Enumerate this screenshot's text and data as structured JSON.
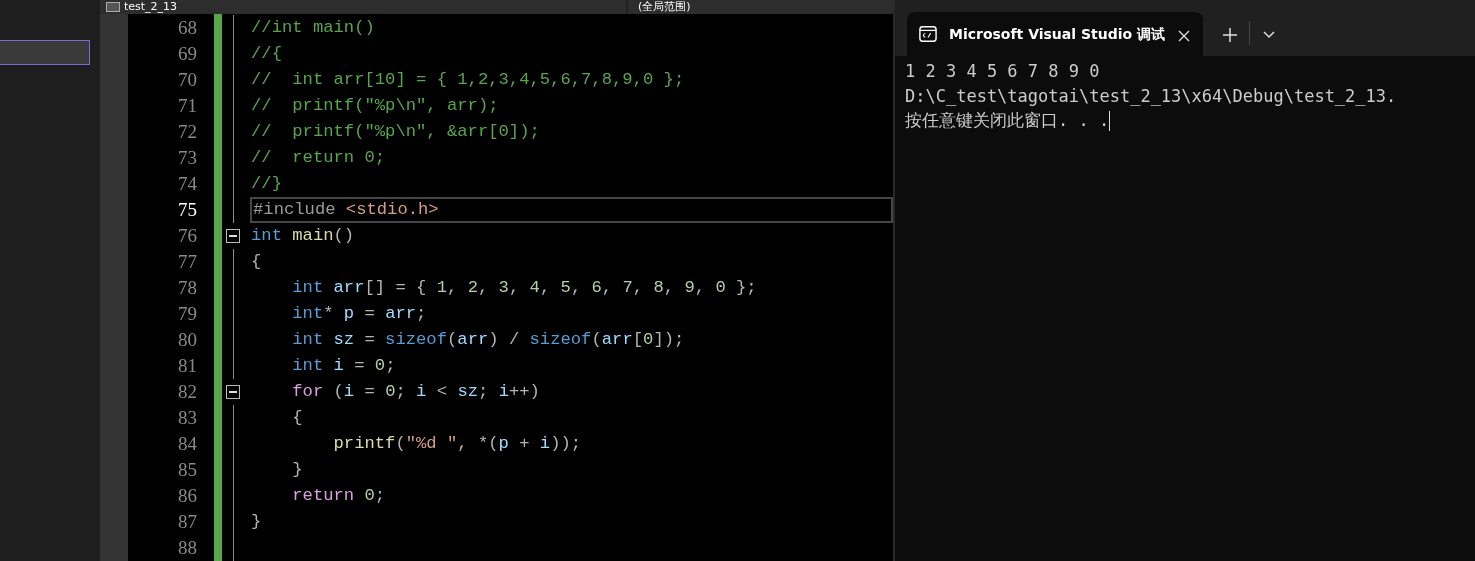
{
  "editor": {
    "file_tab": "test_2_13",
    "scope": "(全局范围)",
    "lines": [
      {
        "number": "68",
        "current": false,
        "foldable": false,
        "tokens": [
          {
            "kind": "comment",
            "text": "//int main()"
          }
        ]
      },
      {
        "number": "69",
        "current": false,
        "foldable": false,
        "tokens": [
          {
            "kind": "comment",
            "text": "//{"
          }
        ]
      },
      {
        "number": "70",
        "current": false,
        "foldable": false,
        "tokens": [
          {
            "kind": "comment",
            "text": "//  int arr[10] = { 1,2,3,4,5,6,7,8,9,0 };"
          }
        ]
      },
      {
        "number": "71",
        "current": false,
        "foldable": false,
        "tokens": [
          {
            "kind": "comment",
            "text": "//  printf(\"%p\\n\", arr);"
          }
        ]
      },
      {
        "number": "72",
        "current": false,
        "foldable": false,
        "tokens": [
          {
            "kind": "comment",
            "text": "//  printf(\"%p\\n\", &arr[0]);"
          }
        ]
      },
      {
        "number": "73",
        "current": false,
        "foldable": false,
        "tokens": [
          {
            "kind": "comment",
            "text": "//  return 0;"
          }
        ]
      },
      {
        "number": "74",
        "current": false,
        "foldable": false,
        "tokens": [
          {
            "kind": "comment",
            "text": "//}"
          }
        ]
      },
      {
        "number": "75",
        "current": true,
        "foldable": false,
        "tokens": [
          {
            "kind": "preproc",
            "text": "#include "
          },
          {
            "kind": "string",
            "text": "<stdio.h>"
          }
        ]
      },
      {
        "number": "76",
        "current": false,
        "foldable": true,
        "tokens": [
          {
            "kind": "keyword",
            "text": "int"
          },
          {
            "kind": "function",
            "text": " main"
          },
          {
            "kind": "punct",
            "text": "()"
          }
        ]
      },
      {
        "number": "77",
        "current": false,
        "foldable": false,
        "tokens": [
          {
            "kind": "punct",
            "text": "{"
          }
        ]
      },
      {
        "number": "78",
        "current": false,
        "foldable": false,
        "tokens": [
          {
            "kind": "keyword",
            "text": "    int"
          },
          {
            "kind": "ident",
            "text": " arr"
          },
          {
            "kind": "punct",
            "text": "[] = { "
          },
          {
            "kind": "number",
            "text": "1"
          },
          {
            "kind": "punct",
            "text": ", "
          },
          {
            "kind": "number",
            "text": "2"
          },
          {
            "kind": "punct",
            "text": ", "
          },
          {
            "kind": "number",
            "text": "3"
          },
          {
            "kind": "punct",
            "text": ", "
          },
          {
            "kind": "number",
            "text": "4"
          },
          {
            "kind": "punct",
            "text": ", "
          },
          {
            "kind": "number",
            "text": "5"
          },
          {
            "kind": "punct",
            "text": ", "
          },
          {
            "kind": "number",
            "text": "6"
          },
          {
            "kind": "punct",
            "text": ", "
          },
          {
            "kind": "number",
            "text": "7"
          },
          {
            "kind": "punct",
            "text": ", "
          },
          {
            "kind": "number",
            "text": "8"
          },
          {
            "kind": "punct",
            "text": ", "
          },
          {
            "kind": "number",
            "text": "9"
          },
          {
            "kind": "punct",
            "text": ", "
          },
          {
            "kind": "number",
            "text": "0"
          },
          {
            "kind": "punct",
            "text": " };"
          }
        ]
      },
      {
        "number": "79",
        "current": false,
        "foldable": false,
        "tokens": [
          {
            "kind": "keyword",
            "text": "    int"
          },
          {
            "kind": "punct",
            "text": "* "
          },
          {
            "kind": "ident",
            "text": "p"
          },
          {
            "kind": "punct",
            "text": " = "
          },
          {
            "kind": "ident",
            "text": "arr"
          },
          {
            "kind": "punct",
            "text": ";"
          }
        ]
      },
      {
        "number": "80",
        "current": false,
        "foldable": false,
        "tokens": [
          {
            "kind": "keyword",
            "text": "    int"
          },
          {
            "kind": "ident",
            "text": " sz"
          },
          {
            "kind": "punct",
            "text": " = "
          },
          {
            "kind": "keyword",
            "text": "sizeof"
          },
          {
            "kind": "punct",
            "text": "("
          },
          {
            "kind": "ident",
            "text": "arr"
          },
          {
            "kind": "punct",
            "text": ") / "
          },
          {
            "kind": "keyword",
            "text": "sizeof"
          },
          {
            "kind": "punct",
            "text": "("
          },
          {
            "kind": "ident",
            "text": "arr"
          },
          {
            "kind": "punct",
            "text": "["
          },
          {
            "kind": "number",
            "text": "0"
          },
          {
            "kind": "punct",
            "text": "]);"
          }
        ]
      },
      {
        "number": "81",
        "current": false,
        "foldable": false,
        "tokens": [
          {
            "kind": "keyword",
            "text": "    int"
          },
          {
            "kind": "ident",
            "text": " i"
          },
          {
            "kind": "punct",
            "text": " = "
          },
          {
            "kind": "number",
            "text": "0"
          },
          {
            "kind": "punct",
            "text": ";"
          }
        ]
      },
      {
        "number": "82",
        "current": false,
        "foldable": true,
        "tokens": [
          {
            "kind": "control",
            "text": "    for"
          },
          {
            "kind": "punct",
            "text": " ("
          },
          {
            "kind": "ident",
            "text": "i"
          },
          {
            "kind": "punct",
            "text": " = "
          },
          {
            "kind": "number",
            "text": "0"
          },
          {
            "kind": "punct",
            "text": "; "
          },
          {
            "kind": "ident",
            "text": "i"
          },
          {
            "kind": "punct",
            "text": " < "
          },
          {
            "kind": "ident",
            "text": "sz"
          },
          {
            "kind": "punct",
            "text": "; "
          },
          {
            "kind": "ident",
            "text": "i"
          },
          {
            "kind": "punct",
            "text": "++)"
          }
        ]
      },
      {
        "number": "83",
        "current": false,
        "foldable": false,
        "tokens": [
          {
            "kind": "punct",
            "text": "    {"
          }
        ]
      },
      {
        "number": "84",
        "current": false,
        "foldable": false,
        "tokens": [
          {
            "kind": "function",
            "text": "        printf"
          },
          {
            "kind": "punct",
            "text": "("
          },
          {
            "kind": "string",
            "text": "\"%d \""
          },
          {
            "kind": "punct",
            "text": ", *("
          },
          {
            "kind": "ident",
            "text": "p"
          },
          {
            "kind": "punct",
            "text": " + "
          },
          {
            "kind": "ident",
            "text": "i"
          },
          {
            "kind": "punct",
            "text": "));"
          }
        ]
      },
      {
        "number": "85",
        "current": false,
        "foldable": false,
        "tokens": [
          {
            "kind": "punct",
            "text": "    }"
          }
        ]
      },
      {
        "number": "86",
        "current": false,
        "foldable": false,
        "tokens": [
          {
            "kind": "control",
            "text": "    return"
          },
          {
            "kind": "number",
            "text": " 0"
          },
          {
            "kind": "punct",
            "text": ";"
          }
        ]
      },
      {
        "number": "87",
        "current": false,
        "foldable": false,
        "tokens": [
          {
            "kind": "punct",
            "text": "}"
          }
        ]
      },
      {
        "number": "88",
        "current": false,
        "foldable": false
      }
    ]
  },
  "terminal": {
    "tab": {
      "title": "Microsoft Visual Studio 调试",
      "selected": true
    },
    "output": [
      "1 2 3 4 5 6 7 8 9 0",
      "D:\\C_test\\tagotai\\test_2_13\\x64\\Debug\\test_2_13.",
      "按任意键关闭此窗口. . ."
    ]
  }
}
